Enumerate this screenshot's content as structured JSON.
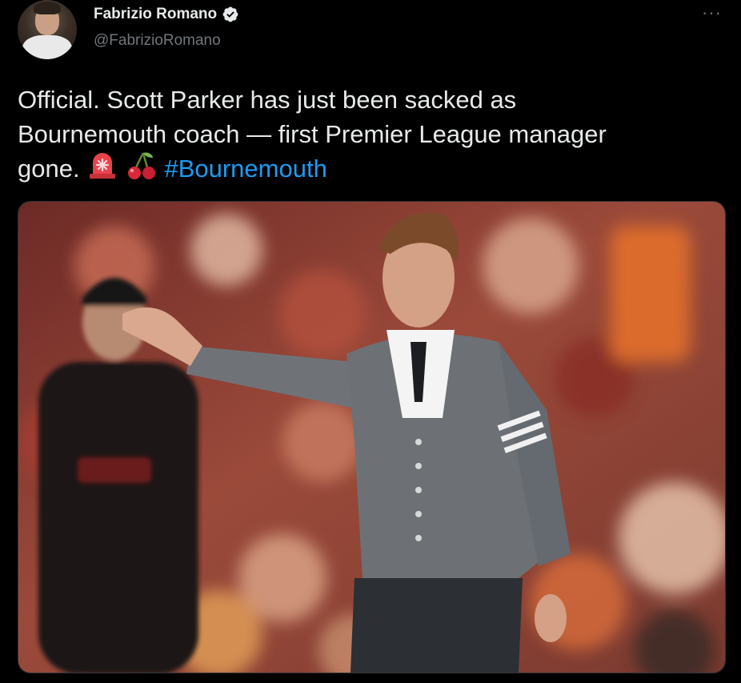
{
  "author": {
    "display_name": "Fabrizio Romano",
    "handle": "@FabrizioRomano",
    "verified": true
  },
  "menu": {
    "more_label": "···"
  },
  "tweet": {
    "text_line1": "Official. Scott Parker has just been sacked as",
    "text_line2": "Bournemouth coach — first Premier League manager",
    "text_line3": "gone.",
    "hashtag": "#Bournemouth",
    "emojis": [
      "rotating-light-icon",
      "cherries-icon"
    ]
  },
  "colors": {
    "background": "#000000",
    "text": "#e7e9ea",
    "secondary_text": "#71767b",
    "link": "#1d9bf0",
    "verified_badge": "#e7e9ea"
  }
}
